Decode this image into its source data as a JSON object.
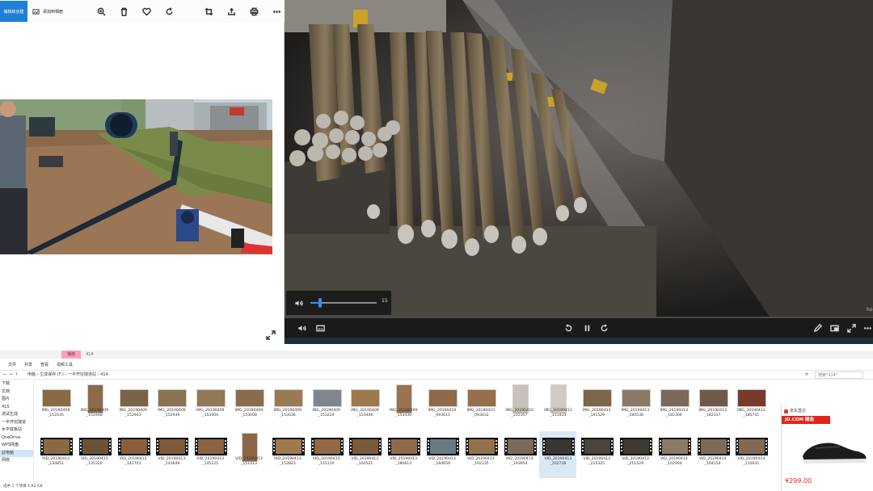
{
  "photos_app": {
    "edit_label": "编辑和创建",
    "add_label": "添加到相册",
    "toolbar_icons": [
      "zoom-icon",
      "delete-icon",
      "favorite-icon",
      "rotate-icon",
      "crop-icon",
      "share-icon",
      "print-icon",
      "more-icon"
    ]
  },
  "video_player": {
    "volume_value": "15",
    "volume_level": 0.15,
    "time_remaining": "hoe"
  },
  "explorer": {
    "active_tab": "播放",
    "title_path": "414",
    "ribbon": [
      "文件",
      "共享",
      "查看",
      "视频工具"
    ],
    "address_path": "电脑 › 生成保存 (F:) › 一半开挖隧道站 › 414",
    "search_placeholder": "搜索\"414\"",
    "sidebar": [
      "下载",
      "文档",
      "图片",
      "415",
      "测试生成",
      "一半开挖隧道",
      "水平底板站",
      "OneDrive",
      "WPS网盘",
      "此电脑",
      "网络"
    ],
    "sidebar_selected": 9,
    "row1": [
      {
        "name": "IMG_20190409\n_152435",
        "kind": "photo",
        "color": "#8a6a44"
      },
      {
        "name": "IMG_20190409\n_152448",
        "kind": "tall",
        "color": "#8d6b4a"
      },
      {
        "name": "IMG_20190409\n_152943",
        "kind": "photo",
        "color": "#7a6446"
      },
      {
        "name": "IMG_20190409\n_152949",
        "kind": "photo",
        "color": "#8a7350"
      },
      {
        "name": "IMG_20190409\n_153004",
        "kind": "photo",
        "color": "#94785a"
      },
      {
        "name": "IMG_20190409\n_153008",
        "kind": "photo",
        "color": "#8b6b4e"
      },
      {
        "name": "IMG_20190409\n_153036",
        "kind": "photo",
        "color": "#9a7a55"
      },
      {
        "name": "IMG_20190409\n_153224",
        "kind": "photo",
        "color": "#7e868c"
      },
      {
        "name": "IMG_20190409\n_153406",
        "kind": "photo",
        "color": "#a0784e"
      },
      {
        "name": "IMG_20190409\n_153430",
        "kind": "tall",
        "color": "#9a7252"
      },
      {
        "name": "IMG_20190410\n_093611",
        "kind": "photo",
        "color": "#8e6a48"
      },
      {
        "name": "IMG_20190410\n_093632",
        "kind": "photo",
        "color": "#976f4a"
      },
      {
        "name": "IMG_20190410\n_222357",
        "kind": "tall",
        "color": "#c8c2b8"
      },
      {
        "name": "IMG_20190413\n_111433",
        "kind": "tall",
        "color": "#cfcbc3"
      },
      {
        "name": "IMG_20190413\n_141529",
        "kind": "photo",
        "color": "#7c6648"
      },
      {
        "name": "IMG_20190413\n_180538",
        "kind": "photo",
        "color": "#8c7a66"
      },
      {
        "name": "IMG_20190413\n_182306",
        "kind": "photo",
        "color": "#7a6a5a"
      },
      {
        "name": "IMG_20190413\n_182317",
        "kind": "photo",
        "color": "#6e5a46"
      },
      {
        "name": "IMG_20190413\n_185741",
        "kind": "photo",
        "color": "#7a3a2a"
      }
    ],
    "row2": [
      {
        "name": "VID_20190413\n_130851",
        "kind": "video",
        "color": "#8a6a44"
      },
      {
        "name": "VID_20190413\n_135320",
        "kind": "video",
        "color": "#6a5236"
      },
      {
        "name": "VID_20190413\n_142701",
        "kind": "video",
        "color": "#8a5e3a"
      },
      {
        "name": "VID_20190413\n_143649",
        "kind": "video",
        "color": "#7e5a38"
      },
      {
        "name": "VID_20190413\n_145225",
        "kind": "video",
        "color": "#8a6440"
      },
      {
        "name": "VID_20190413\n_151413",
        "kind": "tall",
        "color": "#8c6646"
      },
      {
        "name": "VID_20190413\n_153823",
        "kind": "video",
        "color": "#a07a4c"
      },
      {
        "name": "VID_20190413\n_155110",
        "kind": "video",
        "color": "#906a44"
      },
      {
        "name": "VID_20190413\n_160521",
        "kind": "video",
        "color": "#7a5a3a"
      },
      {
        "name": "VID_20190413\n_180613",
        "kind": "video",
        "color": "#8e6c4a"
      },
      {
        "name": "VID_20190413\n_184659",
        "kind": "video",
        "color": "#6a7a80"
      },
      {
        "name": "VID_20190413\n_192235",
        "kind": "video",
        "color": "#94724c"
      },
      {
        "name": "VID_20190413\n_193954",
        "kind": "video",
        "color": "#7a6a5a"
      },
      {
        "name": "VID_20190413\n_202728",
        "kind": "video",
        "color": "#3a3634",
        "selected": true
      },
      {
        "name": "VID_20190413\n_210325",
        "kind": "video",
        "color": "#4a4440"
      },
      {
        "name": "VID_20190413\n_211429",
        "kind": "video",
        "color": "#3e3a36"
      },
      {
        "name": "VID_20190414\n_102904",
        "kind": "video",
        "color": "#8a7a66"
      },
      {
        "name": "VID_20190414\n_104154",
        "kind": "video",
        "color": "#7e6a56"
      },
      {
        "name": "VID_20190414\n_110031",
        "kind": "video",
        "color": "#806a52"
      }
    ],
    "status": "选中 1 个项目  1.92 GB"
  },
  "ad": {
    "header": "京东直达",
    "banner": "JD.COM 精选",
    "price": "¥299.00"
  }
}
